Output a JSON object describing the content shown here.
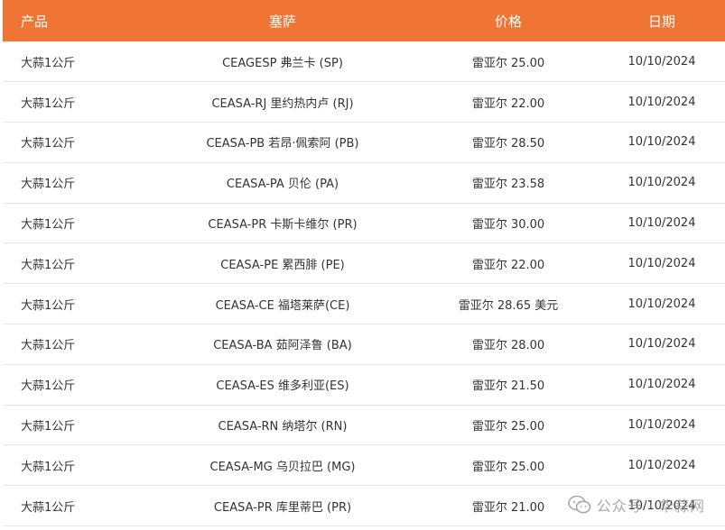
{
  "header": {
    "product": "产品",
    "market": "塞萨",
    "price": "价格",
    "date": "日期"
  },
  "rows": [
    {
      "product": "大蒜1公斤",
      "market": "CEAGESP 弗兰卡 (SP)",
      "price": "雷亚尔 25.00",
      "date": "10/10/2024"
    },
    {
      "product": "大蒜1公斤",
      "market": "CEASA-RJ 里约热内卢 (RJ)",
      "price": "雷亚尔 22.00",
      "date": "10/10/2024"
    },
    {
      "product": "大蒜1公斤",
      "market": "CEASA-PB 若昂·佩索阿 (PB)",
      "price": "雷亚尔 28.50",
      "date": "10/10/2024"
    },
    {
      "product": "大蒜1公斤",
      "market": "CEASA-PA 贝伦 (PA)",
      "price": "雷亚尔 23.58",
      "date": "10/10/2024"
    },
    {
      "product": "大蒜1公斤",
      "market": "CEASA-PR 卡斯卡维尔 (PR)",
      "price": "雷亚尔 30.00",
      "date": "10/10/2024"
    },
    {
      "product": "大蒜1公斤",
      "market": "CEASA-PE 累西腓 (PE)",
      "price": "雷亚尔 22.00",
      "date": "10/10/2024"
    },
    {
      "product": "大蒜1公斤",
      "market": "CEASA-CE 福塔莱萨(CE)",
      "price": "雷亚尔 28.65 美元",
      "date": "10/10/2024"
    },
    {
      "product": "大蒜1公斤",
      "market": "CEASA-BA 茹阿泽鲁 (BA)",
      "price": "雷亚尔 28.00",
      "date": "10/10/2024"
    },
    {
      "product": "大蒜1公斤",
      "market": "CEASA-ES 维多利亚(ES)",
      "price": "雷亚尔 21.50",
      "date": "10/10/2024"
    },
    {
      "product": "大蒜1公斤",
      "market": "CEASA-RN 纳塔尔 (RN)",
      "price": "雷亚尔 25.00",
      "date": "10/10/2024"
    },
    {
      "product": "大蒜1公斤",
      "market": "CEASA-MG 乌贝拉巴 (MG)",
      "price": "雷亚尔 25.00",
      "date": "10/10/2024"
    },
    {
      "product": "大蒜1公斤",
      "market": "CEASA-PR 库里蒂巴 (PR)",
      "price": "雷亚尔 21.00",
      "date": "10/10/2024"
    }
  ],
  "watermark": {
    "icon": "wechat-icon",
    "text": "公众号 · 华蒜网"
  },
  "colors": {
    "header_bg": "#f07535",
    "header_text": "#ffffff",
    "row_text": "#333333",
    "divider": "#e6e6e6"
  }
}
